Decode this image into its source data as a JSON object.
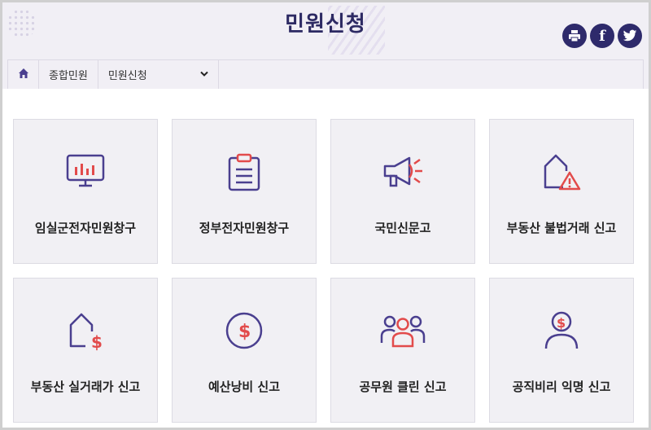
{
  "header": {
    "title": "민원신청",
    "social": [
      {
        "icon": "print-icon"
      },
      {
        "icon": "facebook-icon",
        "glyph": "f"
      },
      {
        "icon": "twitter-icon"
      }
    ]
  },
  "breadcrumb": {
    "home_icon": "home-icon",
    "items": [
      {
        "label": "종합민원"
      },
      {
        "label": "민원신청",
        "dropdown": true
      }
    ]
  },
  "cards": [
    {
      "label": "임실군전자민원창구",
      "icon": "monitor-chart-icon"
    },
    {
      "label": "정부전자민원창구",
      "icon": "clipboard-icon"
    },
    {
      "label": "국민신문고",
      "icon": "megaphone-icon"
    },
    {
      "label": "부동산 불법거래 신고",
      "icon": "house-warning-icon"
    },
    {
      "label": "부동산 실거래가 신고",
      "icon": "house-dollar-icon"
    },
    {
      "label": "예산낭비 신고",
      "icon": "dollar-coin-icon"
    },
    {
      "label": "공무원 클린 신고",
      "icon": "people-group-icon"
    },
    {
      "label": "공직비리 익명 신고",
      "icon": "person-dollar-icon"
    }
  ],
  "colors": {
    "accent_dark": "#2e2a6b",
    "icon_purple": "#4a3f8f",
    "icon_red": "#e24b4b",
    "card_bg": "#f1f0f4"
  }
}
